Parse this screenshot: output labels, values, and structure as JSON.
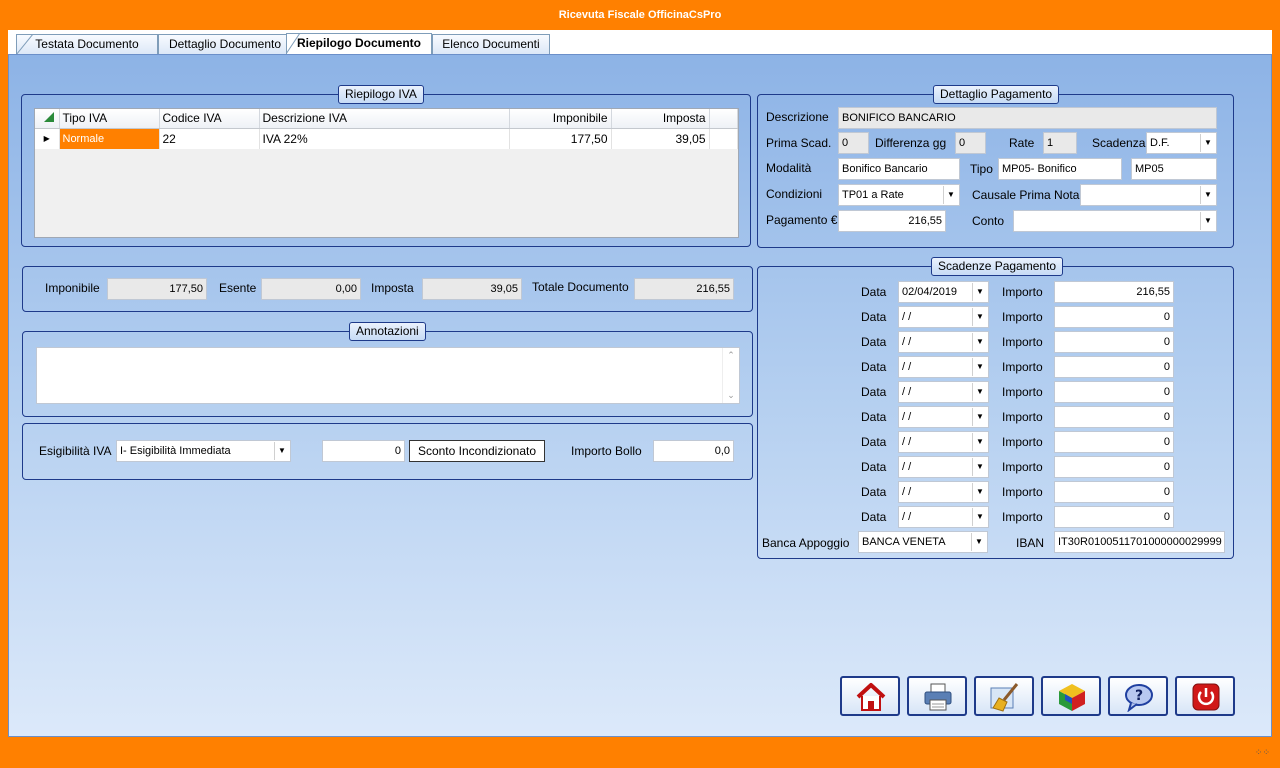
{
  "window": {
    "title": "Ricevuta Fiscale OfficinaCsPro"
  },
  "tabs": [
    {
      "label": "Testata Documento"
    },
    {
      "label": "Dettaglio Documento"
    },
    {
      "label": "Riepilogo Documento"
    },
    {
      "label": "Elenco Documenti"
    }
  ],
  "riepilogo_iva": {
    "title": "Riepilogo IVA",
    "columns": [
      "Tipo IVA",
      "Codice IVA",
      "Descrizione IVA",
      "Imponibile",
      "Imposta"
    ],
    "rows": [
      {
        "tipo": "Normale",
        "codice": "22",
        "descrizione": "IVA 22%",
        "imponibile": "177,50",
        "imposta": "39,05"
      }
    ]
  },
  "totals": {
    "imponibile_label": "Imponibile",
    "imponibile": "177,50",
    "esente_label": "Esente",
    "esente": "0,00",
    "imposta_label": "Imposta",
    "imposta": "39,05",
    "totale_label": "Totale Documento",
    "totale": "216,55"
  },
  "annotazioni": {
    "title": "Annotazioni",
    "text": ""
  },
  "esigibilita": {
    "label": "Esigibilità IVA",
    "value": "I- Esigibilità Immediata",
    "sconto_value": "0",
    "sconto_button": "Sconto Incondizionato",
    "bollo_label": "Importo Bollo",
    "bollo": "0,0"
  },
  "pagamento": {
    "title": "Dettaglio Pagamento",
    "descrizione_label": "Descrizione",
    "descrizione": "BONIFICO BANCARIO",
    "prima_scad_label": "Prima Scad.",
    "prima_scad": "0",
    "differenza_label": "Differenza gg",
    "differenza": "0",
    "rate_label": "Rate",
    "rate": "1",
    "scadenza_label": "Scadenza",
    "scadenza": "D.F.",
    "modalita_label": "Modalità",
    "modalita": "Bonifico Bancario",
    "tipo_label": "Tipo",
    "tipo": "MP05- Bonifico",
    "tipo_code": "MP05",
    "condizioni_label": "Condizioni",
    "condizioni": "TP01 a Rate",
    "causale_label": "Causale Prima Nota",
    "causale": "",
    "pagamento_label": "Pagamento €",
    "pagamento": "216,55",
    "conto_label": "Conto",
    "conto": ""
  },
  "scadenze": {
    "title": "Scadenze Pagamento",
    "data_label": "Data",
    "importo_label": "Importo",
    "rows": [
      {
        "data": "02/04/2019",
        "importo": "216,55"
      },
      {
        "data": " /  /",
        "importo": "0"
      },
      {
        "data": " /  /",
        "importo": "0"
      },
      {
        "data": " /  /",
        "importo": "0"
      },
      {
        "data": " /  /",
        "importo": "0"
      },
      {
        "data": " /  /",
        "importo": "0"
      },
      {
        "data": " /  /",
        "importo": "0"
      },
      {
        "data": " /  /",
        "importo": "0"
      },
      {
        "data": " /  /",
        "importo": "0"
      },
      {
        "data": " /  /",
        "importo": "0"
      }
    ],
    "banca_label": "Banca Appoggio",
    "banca": "BANCA VENETA",
    "iban_label": "IBAN",
    "iban": "IT30R0100511701000000029999"
  },
  "toolbar": [
    {
      "name": "home-icon"
    },
    {
      "name": "printer-icon"
    },
    {
      "name": "broom-icon"
    },
    {
      "name": "cube-icon"
    },
    {
      "name": "help-icon"
    },
    {
      "name": "power-icon"
    }
  ],
  "colors": {
    "accent": "#ff8000",
    "selection": "#ff8000",
    "group_border": "#1e3a8a"
  }
}
